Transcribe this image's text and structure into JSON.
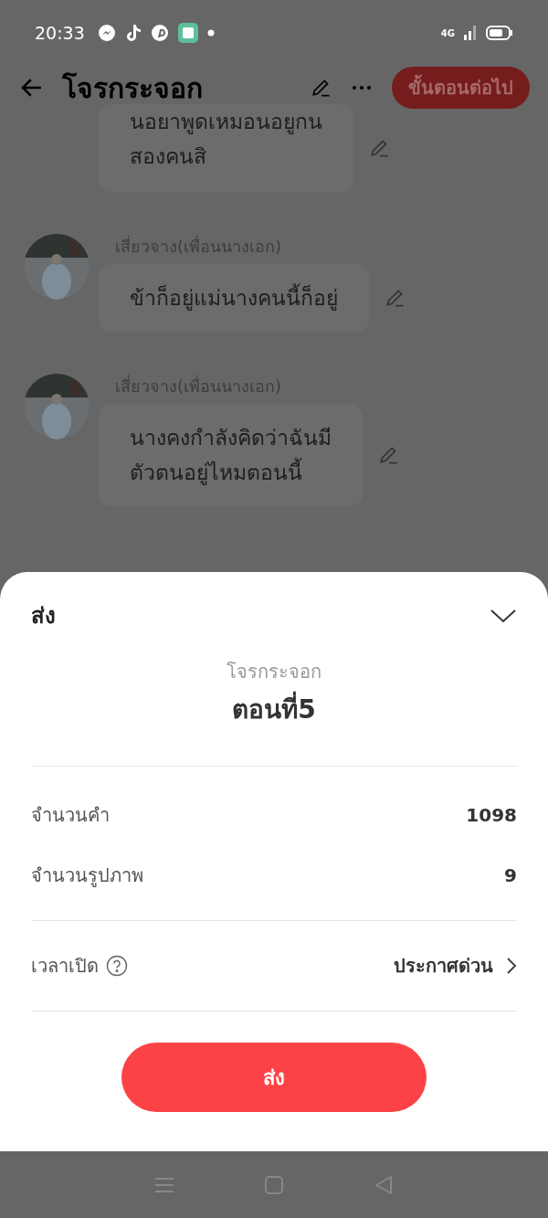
{
  "status_bar": {
    "time": "20:33",
    "network": "4G"
  },
  "header": {
    "title": "โจรกระจอก",
    "next_button": "ขั้นตอนต่อไป"
  },
  "messages": [
    {
      "kind": "cut",
      "lines": [
        "นอยาพูดเหมอนอยูกน",
        "สองคนสิ"
      ]
    },
    {
      "kind": "full",
      "speaker": "เสี่ยวจาง(เพื่อนนางเอก)",
      "lines": [
        "ข้าก็อยู่แม่นางคนนี้ก็อยู่"
      ]
    },
    {
      "kind": "full",
      "speaker": "เสี่ยวจาง(เพื่อนนางเอก)",
      "lines": [
        "นางคงกำลังคิดว่าฉันมี",
        "ตัวตนอยู่ไหมตอนนี้"
      ]
    }
  ],
  "sheet": {
    "title": "ส่ง",
    "story": "โจรกระจอก",
    "episode": "ตอนที่5",
    "stats": [
      {
        "label": "จำนวนคำ",
        "value": "1098"
      },
      {
        "label": "จำนวนรูปภาพ",
        "value": "9"
      }
    ],
    "open_time": {
      "label": "เวลาเปิด",
      "value": "ประกาศด่วน"
    },
    "submit": "ส่ง"
  }
}
